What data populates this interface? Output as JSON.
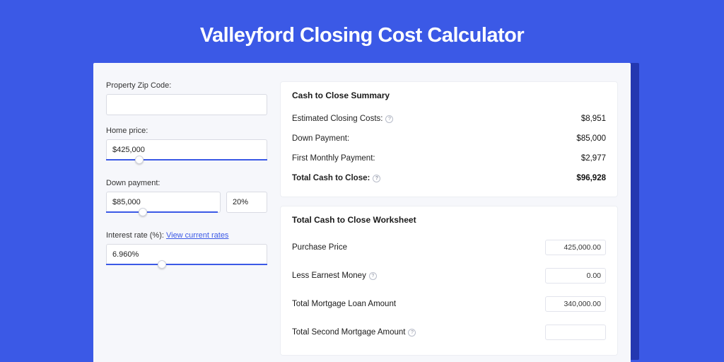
{
  "title": "Valleyford Closing Cost Calculator",
  "form": {
    "zip": {
      "label": "Property Zip Code:",
      "value": ""
    },
    "home_price": {
      "label": "Home price:",
      "value": "$425,000",
      "slider_pct": 18
    },
    "down_payment": {
      "label": "Down payment:",
      "value": "$85,000",
      "pct_value": "20%",
      "slider_pct": 20
    },
    "interest_rate": {
      "label": "Interest rate (%):",
      "link": "View current rates",
      "value": "6.960%",
      "slider_pct": 32
    }
  },
  "summary": {
    "title": "Cash to Close Summary",
    "rows": [
      {
        "label": "Estimated Closing Costs:",
        "help": true,
        "value": "$8,951",
        "bold": false
      },
      {
        "label": "Down Payment:",
        "help": false,
        "value": "$85,000",
        "bold": false
      },
      {
        "label": "First Monthly Payment:",
        "help": false,
        "value": "$2,977",
        "bold": false
      },
      {
        "label": "Total Cash to Close:",
        "help": true,
        "value": "$96,928",
        "bold": true
      }
    ]
  },
  "worksheet": {
    "title": "Total Cash to Close Worksheet",
    "rows": [
      {
        "label": "Purchase Price",
        "help": false,
        "value": "425,000.00"
      },
      {
        "label": "Less Earnest Money",
        "help": true,
        "value": "0.00"
      },
      {
        "label": "Total Mortgage Loan Amount",
        "help": false,
        "value": "340,000.00"
      },
      {
        "label": "Total Second Mortgage Amount",
        "help": true,
        "value": ""
      }
    ]
  }
}
